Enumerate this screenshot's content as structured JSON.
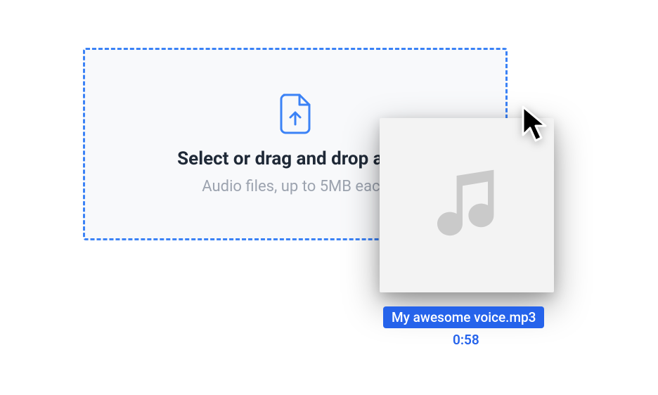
{
  "dropzone": {
    "title": "Select or drag and drop a file",
    "subtitle": "Audio files, up to 5MB each"
  },
  "file": {
    "name": "My awesome voice.mp3",
    "duration": "0:58"
  },
  "icons": {
    "upload": "upload-file-icon",
    "music": "music-note-icon",
    "cursor": "cursor-icon"
  }
}
